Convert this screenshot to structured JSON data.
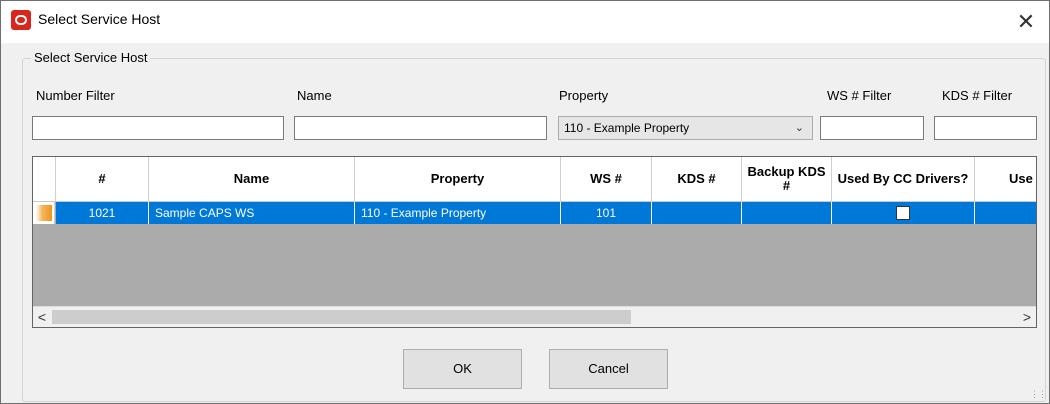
{
  "window": {
    "title": "Select Service Host",
    "close_symbol": "✕"
  },
  "group": {
    "legend": "Select Service Host"
  },
  "filters": {
    "number_label": "Number Filter",
    "number_value": "",
    "name_label": "Name",
    "name_value": "",
    "property_label": "Property",
    "property_selected": "110 - Example Property",
    "ws_label": "WS # Filter",
    "ws_value": "",
    "kds_label": "KDS # Filter",
    "kds_value": ""
  },
  "grid": {
    "columns": [
      "#",
      "Name",
      "Property",
      "WS #",
      "KDS #",
      "Backup KDS #",
      "Used By CC Drivers?",
      "Use Inter"
    ],
    "rows": [
      {
        "number": "1021",
        "name": "Sample CAPS WS",
        "property": "110 - Example Property",
        "ws": "101",
        "kds": "",
        "backup_kds": "",
        "used_by_cc_drivers": false,
        "inter": ""
      }
    ]
  },
  "scrollbar": {
    "left_arrow": "<",
    "right_arrow": ">"
  },
  "buttons": {
    "ok": "OK",
    "cancel": "Cancel"
  },
  "colors": {
    "selection": "#0078d7",
    "app_icon": "#d9261c",
    "row_indicator": "#ee9520"
  },
  "icons": {
    "app": "oracle-logo-icon",
    "close": "close-icon",
    "dropdown": "chevron-down-icon"
  }
}
